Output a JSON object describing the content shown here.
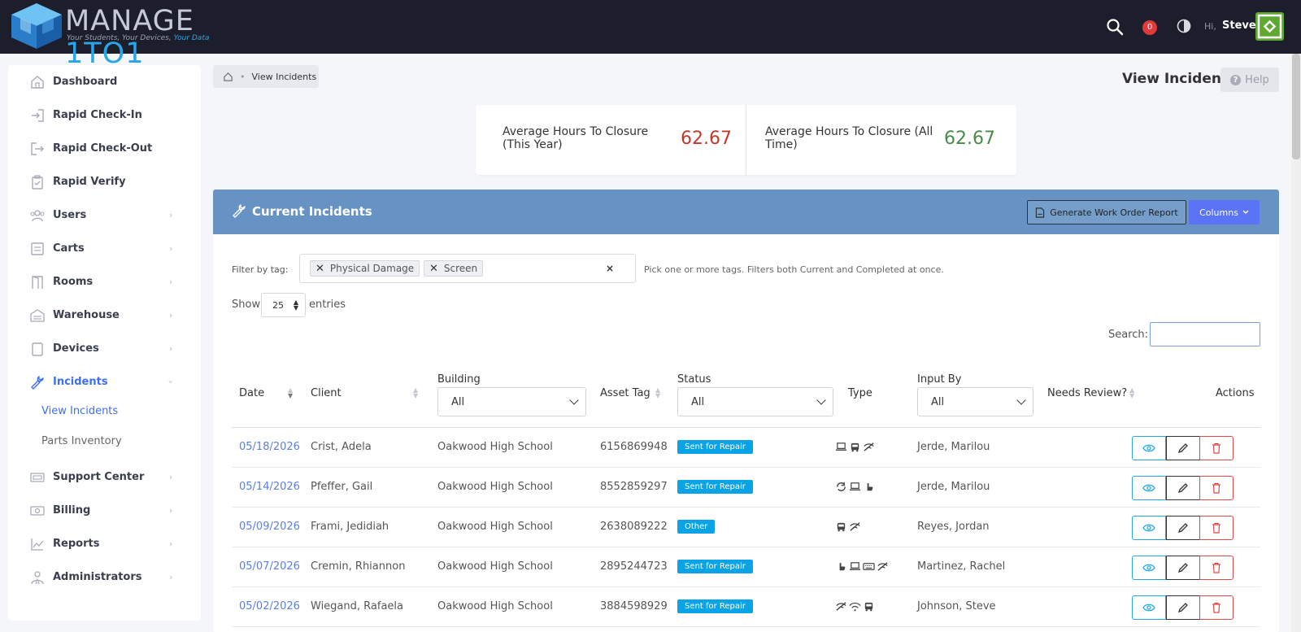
{
  "brand": {
    "word_main": "MANAGE ",
    "word_accent": "1TO1",
    "tagline_main": "Your Students, Your Devices, ",
    "tagline_accent": "Your Data",
    "accent_color": "#2aa6e8"
  },
  "topbar": {
    "notification_count": "0",
    "greeting": "Hi,",
    "user_name": "Steve"
  },
  "sidebar": {
    "items": [
      {
        "label": "Dashboard",
        "icon": "home-icon"
      },
      {
        "label": "Rapid Check-In",
        "icon": "check-in-icon"
      },
      {
        "label": "Rapid Check-Out",
        "icon": "check-out-icon"
      },
      {
        "label": "Rapid Verify",
        "icon": "clipboard-check-icon"
      },
      {
        "label": "Users",
        "icon": "users-icon"
      },
      {
        "label": "Carts",
        "icon": "cart-icon"
      },
      {
        "label": "Rooms",
        "icon": "rooms-icon"
      },
      {
        "label": "Warehouse",
        "icon": "warehouse-icon"
      },
      {
        "label": "Devices",
        "icon": "device-icon"
      },
      {
        "label": "Incidents",
        "icon": "wrench-icon"
      },
      {
        "label": "Support Center",
        "icon": "ticket-icon"
      },
      {
        "label": "Billing",
        "icon": "money-icon"
      },
      {
        "label": "Reports",
        "icon": "chart-icon"
      },
      {
        "label": "Administrators",
        "icon": "admin-icon"
      }
    ],
    "subitems": [
      {
        "label": "View Incidents"
      },
      {
        "label": "Parts Inventory"
      }
    ]
  },
  "breadcrumb": {
    "current": "View Incidents"
  },
  "page": {
    "title": "View Incidents",
    "help_label": "Help"
  },
  "stats": {
    "this_year_label": "Average Hours To Closure (This Year)",
    "this_year_value": "62.67",
    "this_year_color": "#c0392b",
    "all_time_label": "Average Hours To Closure (All Time)",
    "all_time_value": "62.67",
    "all_time_color": "#4a8a4a"
  },
  "panel": {
    "title": "Current Incidents",
    "generate_label": "Generate Work Order Report",
    "columns_label": "Columns",
    "filter_label": "Filter by tag:",
    "tags": [
      "Physical Damage",
      "Screen"
    ],
    "filter_hint": "Pick one or more tags. Filters both Current and Completed at once.",
    "show_label": "Show",
    "show_value": "25",
    "entries_label": "entries",
    "search_label": "Search:"
  },
  "table": {
    "headers": {
      "date": "Date",
      "client": "Client",
      "building": "Building",
      "asset_tag": "Asset Tag",
      "status": "Status",
      "type": "Type",
      "input_by": "Input By",
      "needs_review": "Needs Review?",
      "actions": "Actions"
    },
    "filters": {
      "building": "All",
      "status": "All",
      "input_by": "All"
    },
    "rows": [
      {
        "date": "05/18/2026",
        "client": "Crist, Adela",
        "building": "Oakwood High School",
        "asset": "6156869948",
        "status": "Sent for Repair",
        "types": [
          "laptop-icon",
          "bus-icon",
          "no-wifi-icon"
        ],
        "input_by": "Jerde, Marilou"
      },
      {
        "date": "05/14/2026",
        "client": "Pfeffer, Gail",
        "building": "Oakwood High School",
        "asset": "8552859297",
        "status": "Sent for Repair",
        "types": [
          "refresh-icon",
          "laptop-icon",
          "hand-icon"
        ],
        "input_by": "Jerde, Marilou"
      },
      {
        "date": "05/09/2026",
        "client": "Frami, Jedidiah",
        "building": "Oakwood High School",
        "asset": "2638089222",
        "status": "Other",
        "types": [
          "bus-icon",
          "no-wifi-icon"
        ],
        "input_by": "Reyes, Jordan"
      },
      {
        "date": "05/07/2026",
        "client": "Cremin, Rhiannon",
        "building": "Oakwood High School",
        "asset": "2895244723",
        "status": "Sent for Repair",
        "types": [
          "hand-icon",
          "laptop-icon",
          "keyboard-icon",
          "no-wifi-icon"
        ],
        "input_by": "Martinez, Rachel"
      },
      {
        "date": "05/02/2026",
        "client": "Wiegand, Rafaela",
        "building": "Oakwood High School",
        "asset": "3884598929",
        "status": "Sent for Repair",
        "types": [
          "no-wifi-icon",
          "wifi-icon",
          "bus-icon"
        ],
        "input_by": "Johnson, Steve"
      }
    ]
  }
}
